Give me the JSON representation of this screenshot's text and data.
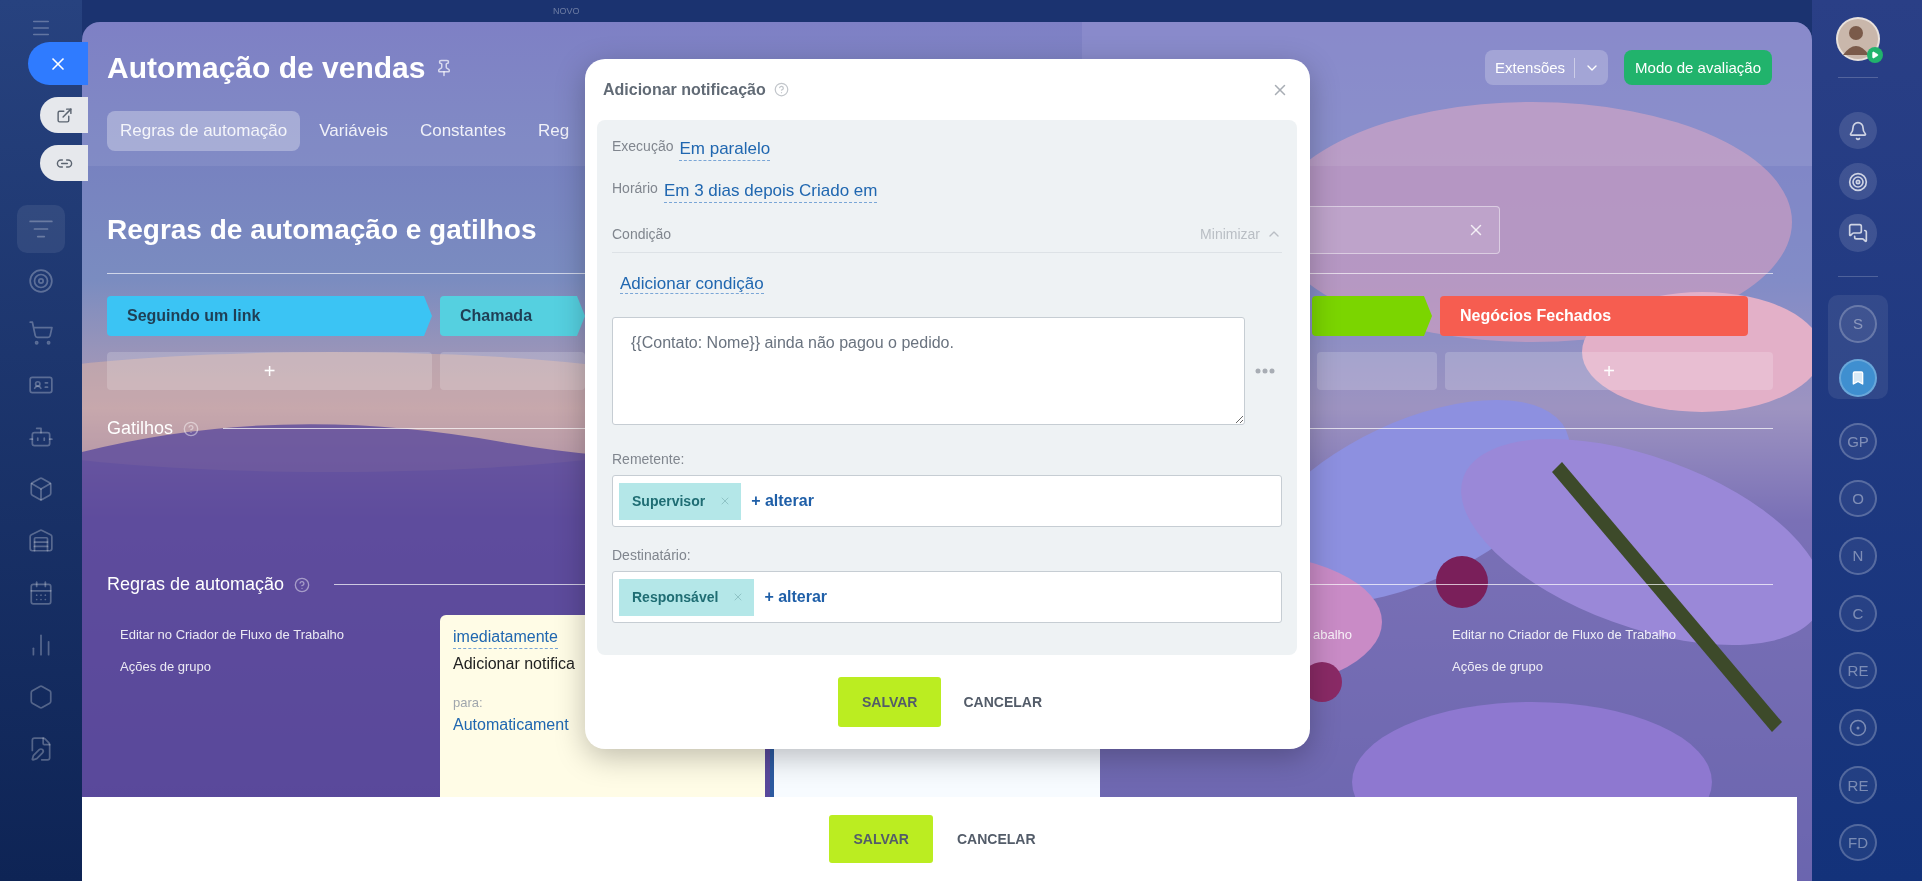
{
  "left_nav": [
    {
      "kind": "menu",
      "selected": false
    },
    {
      "kind": "filter",
      "selected": true
    },
    {
      "kind": "target",
      "selected": false
    },
    {
      "kind": "cart",
      "selected": false
    },
    {
      "kind": "card",
      "selected": false
    },
    {
      "kind": "robot",
      "selected": false
    },
    {
      "kind": "box",
      "selected": false
    },
    {
      "kind": "building",
      "selected": false
    },
    {
      "kind": "calendar",
      "selected": false
    },
    {
      "kind": "chart",
      "selected": false
    },
    {
      "kind": "hexagon",
      "selected": false
    },
    {
      "kind": "document",
      "selected": false
    }
  ],
  "top_badge": "NOVO",
  "header": {
    "title": "Automação de vendas",
    "tabs": [
      {
        "label": "Regras de automação",
        "selected": true
      },
      {
        "label": "Variáveis",
        "selected": false
      },
      {
        "label": "Constantes",
        "selected": false
      },
      {
        "label": "Reg",
        "selected": false
      }
    ],
    "extensions_button": "Extensões",
    "trial_button": "Modo de avaliação"
  },
  "section_title": "Regras de automação e gatilhos",
  "stages": [
    {
      "label": "Seguindo um link",
      "color": "#3bc4f4",
      "add": "+"
    },
    {
      "label": "Chamada",
      "color": "#55d0e0"
    },
    {
      "color": "#7bd500"
    },
    {
      "label": "Negócios Fechados",
      "color": "#f65d50",
      "add": "+"
    }
  ],
  "triggers_title": "Gatilhos",
  "rules_title": "Regras de automação",
  "rules": {
    "left_links": [
      "Editar no Criador de Fluxo de Trabalho",
      "Ações de grupo"
    ],
    "card": {
      "delay": "imediatamente",
      "action": "Adicionar notifica",
      "for_label": "para:",
      "for_value": "Automaticament"
    },
    "partial_link": "abalho",
    "right_links": [
      "Editar no Criador de Fluxo de Trabalho",
      "Ações de grupo"
    ]
  },
  "footer": {
    "save": "SALVAR",
    "cancel": "CANCELAR"
  },
  "right_sidebar": {
    "tools": [
      {
        "kind": "bell"
      },
      {
        "kind": "target"
      },
      {
        "kind": "chat"
      }
    ],
    "pinned": [
      {
        "kind": "initials",
        "label": "S",
        "selected": false
      },
      {
        "kind": "bookmark",
        "selected": true
      }
    ],
    "chats": [
      {
        "kind": "initials",
        "label": "GP"
      },
      {
        "kind": "initials",
        "label": "O"
      },
      {
        "kind": "initials",
        "label": "N"
      },
      {
        "kind": "initials",
        "label": "C"
      },
      {
        "kind": "initials",
        "label": "RE"
      },
      {
        "kind": "icon"
      },
      {
        "kind": "initials",
        "label": "RE"
      },
      {
        "kind": "initials",
        "label": "FD"
      }
    ]
  },
  "modal": {
    "title": "Adicionar notificação",
    "rows": [
      {
        "label": "Execução",
        "value": "Em paralelo"
      },
      {
        "label": "Horário",
        "value": "Em 3 dias depois Criado em"
      }
    ],
    "condition": {
      "label": "Condição",
      "toggle": "Minimizar",
      "expanded": true,
      "add_link": "Adicionar condição"
    },
    "message": "{{Contato: Nome}} ainda não pagou o pedido.",
    "sender": {
      "label": "Remetente:",
      "tags": [
        "Supervisor"
      ],
      "add": "+ alterar"
    },
    "recipient": {
      "label": "Destinatário:",
      "tags": [
        "Responsável"
      ],
      "add": "+ alterar"
    },
    "save": "SALVAR",
    "cancel": "CANCELAR"
  }
}
